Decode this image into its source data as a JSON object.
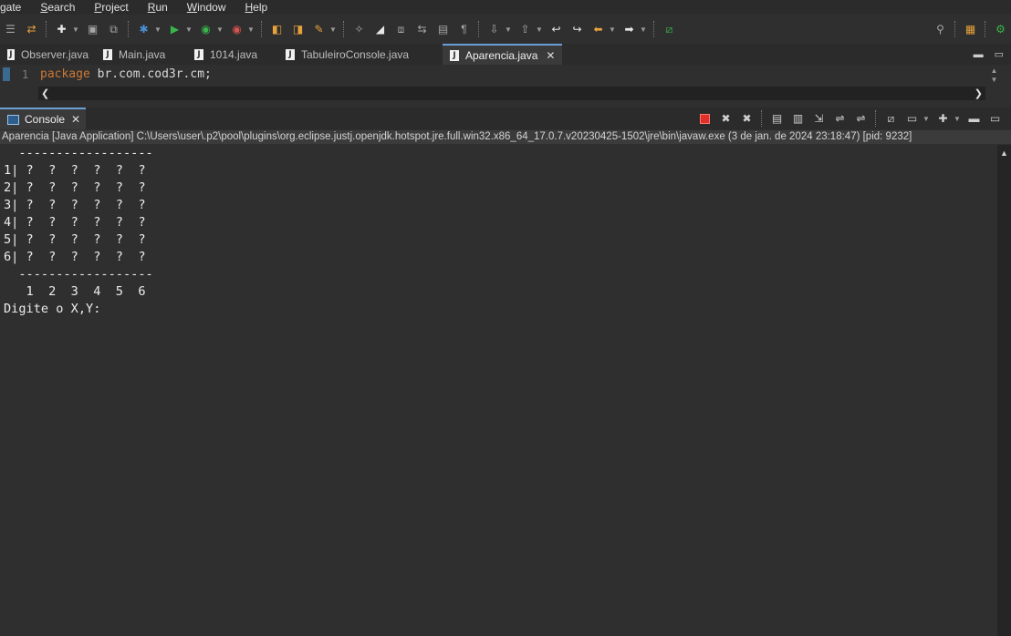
{
  "menu": {
    "items": [
      {
        "label": "gate",
        "accel": ""
      },
      {
        "label": "earch",
        "accel": "S"
      },
      {
        "label": "roject",
        "accel": "P"
      },
      {
        "label": "un",
        "accel": "R"
      },
      {
        "label": "indow",
        "accel": "W"
      },
      {
        "label": "elp",
        "accel": "H"
      }
    ]
  },
  "toolbar": {
    "icons": [
      "new-icon",
      "save-icon",
      "save-all-icon",
      "debug-icon",
      "run-icon",
      "coverage-icon",
      "external-tools-icon",
      "open-type-icon",
      "open-task-icon",
      "search-icon",
      "next-annotation-icon",
      "prev-annotation-icon",
      "back-icon",
      "forward-icon",
      "perspective-icon"
    ]
  },
  "editor_tabs": [
    {
      "label": "Observer.java",
      "active": false
    },
    {
      "label": "Main.java",
      "active": false
    },
    {
      "label": "1014.java",
      "active": false
    },
    {
      "label": "TabuleiroConsole.java",
      "active": false
    },
    {
      "label": "Aparencia.java",
      "active": true
    }
  ],
  "editor": {
    "line_number": "1",
    "keyword": "package",
    "code_rest": " br.com.cod3r.cm;"
  },
  "console": {
    "tab_label": "Console",
    "launch_info": "Aparencia [Java Application] C:\\Users\\user\\.p2\\pool\\plugins\\org.eclipse.justj.openjdk.hotspot.jre.full.win32.x86_64_17.0.7.v20230425-1502\\jre\\bin\\javaw.exe  (3 de jan. de 2024 23:18:47) [pid: 9232]",
    "output_lines": [
      "  ------------------",
      "1| ?  ?  ?  ?  ?  ?",
      "2| ?  ?  ?  ?  ?  ?",
      "3| ?  ?  ?  ?  ?  ?",
      "4| ?  ?  ?  ?  ?  ?",
      "5| ?  ?  ?  ?  ?  ?",
      "6| ?  ?  ?  ?  ?  ?",
      "  ------------------",
      "   1  2  3  4  5  6",
      "Digite o X,Y:"
    ]
  },
  "colors": {
    "background": "#2f2f2f",
    "keyword": "#cc7832",
    "active_tab_border": "#6a9fd4",
    "terminate": "#e0302b"
  }
}
